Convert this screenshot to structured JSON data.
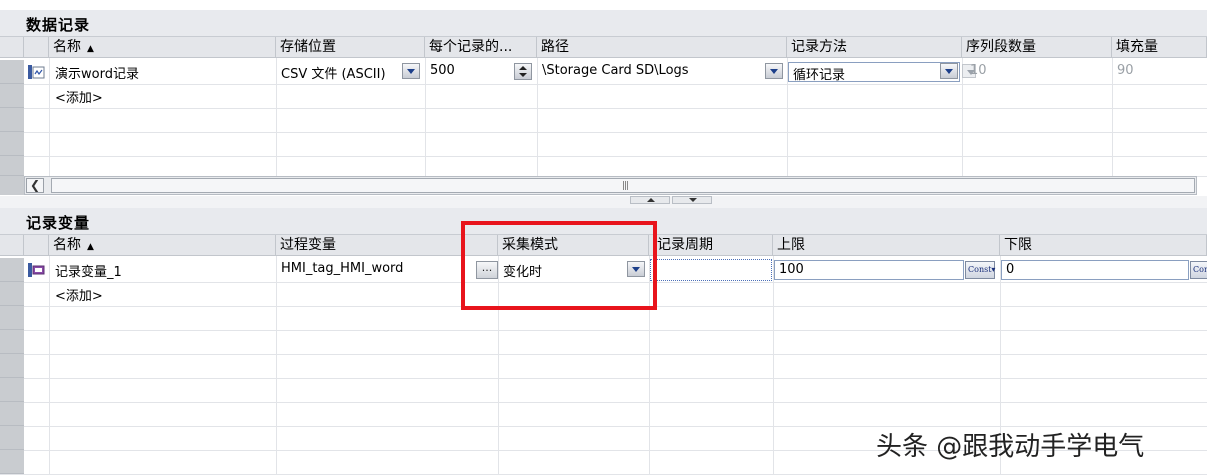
{
  "data_log": {
    "title": "数据记录",
    "columns": [
      "名称",
      "存储位置",
      "每个记录的...",
      "路径",
      "记录方法",
      "序列段数量",
      "填充量"
    ],
    "rows": [
      {
        "name": "演示word记录",
        "storage": "CSV 文件 (ASCII)",
        "records": "500",
        "path": "\\Storage Card SD\\Logs",
        "method": "循环记录",
        "segments": "10",
        "fill": "90"
      }
    ],
    "add_label": "<添加>"
  },
  "log_tags": {
    "title": "记录变量",
    "columns": [
      "名称",
      "过程变量",
      "采集模式",
      "记录周期",
      "上限",
      "下限"
    ],
    "rows": [
      {
        "name": "记录变量_1",
        "process_tag": "HMI_tag_HMI_word",
        "ellipsis": "...",
        "mode": "变化时",
        "cycle": "",
        "upper": "100",
        "upper_const": "Const",
        "lower": "0",
        "lower_const": "Con"
      }
    ],
    "add_label": "<添加>"
  },
  "scrollbar": {
    "grip": "|||"
  },
  "watermark": "头条 @跟我动手学电气",
  "colors": {
    "highlight": "#e8141c",
    "header_bg": "#e4e6ea",
    "gutter": "#c9ccd0"
  }
}
